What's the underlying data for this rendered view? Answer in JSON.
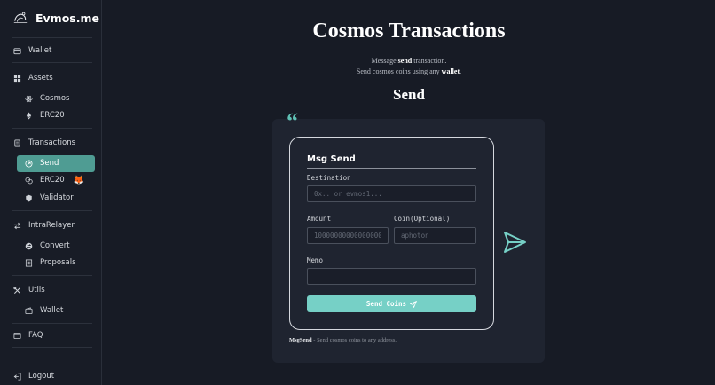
{
  "sidebar": {
    "brand": "Evmos.me",
    "items": {
      "wallet": "Wallet",
      "assets": "Assets",
      "cosmos": "Cosmos",
      "erc20_assets": "ERC20",
      "transactions": "Transactions",
      "send": "Send",
      "erc20_tx": "ERC20",
      "fox": "🦊",
      "validator": "Validator",
      "intrarelayer": "IntraRelayer",
      "convert": "Convert",
      "proposals": "Proposals",
      "utils": "Utils",
      "utils_wallet": "Wallet",
      "faq": "FAQ",
      "logout": "Logout"
    }
  },
  "main": {
    "title": "Cosmos Transactions",
    "subtitle_line1": {
      "prefix": "Message ",
      "bold": "send",
      "suffix": " transaction."
    },
    "subtitle_line2": {
      "prefix": "Send cosmos coins using any ",
      "bold": "wallet",
      "suffix": "."
    },
    "section_title": "Send",
    "quote_mark": "“",
    "card": {
      "title": "Msg Send",
      "destination_label": "Destination",
      "destination_placeholder": "0x.. or evmos1...",
      "amount_label": "Amount",
      "amount_placeholder": "1000000000000000000",
      "coin_label": "Coin(Optional)",
      "coin_placeholder": "aphoton",
      "memo_label": "Memo",
      "memo_value": "",
      "send_button": "Send Coins"
    },
    "footnote": {
      "bold": "MsgSend",
      "text": " - Send cosmos coins to any address."
    }
  },
  "colors": {
    "accent": "#76d0c6",
    "active_nav": "#4f9c93",
    "background": "#171b25",
    "panel": "#1f2430"
  }
}
